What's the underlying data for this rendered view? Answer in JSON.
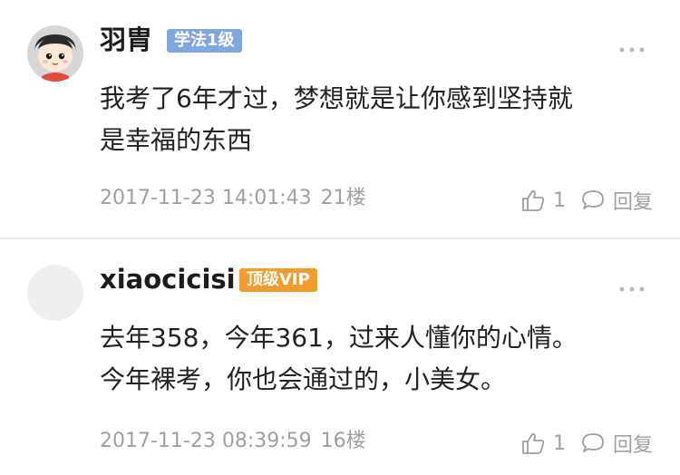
{
  "comments": [
    {
      "username": "羽胄",
      "badge": "学法1级",
      "content_line1": "我考了6年才过，梦想就是让你感到坚持就",
      "content_line2": "是幸福的东西",
      "timestamp": "2017-11-23 14:01:43",
      "floor": "21楼",
      "likes": "1",
      "reply_label": "回复",
      "badge_color": "#7fa6e0"
    },
    {
      "username": "xiaocicisi",
      "badge": "顶级VIP",
      "content_line1": "去年358，今年361，过来人懂你的心情。",
      "content_line2": "今年裸考，你也会通过的，小美女。",
      "timestamp": "2017-11-23 08:39:59",
      "floor": "16楼",
      "likes": "1",
      "reply_label": "回复",
      "badge_color": "#f39c2c"
    }
  ],
  "icons": {
    "more": "more-dots-icon",
    "like": "thumbs-up-icon",
    "reply": "speech-bubble-icon"
  }
}
